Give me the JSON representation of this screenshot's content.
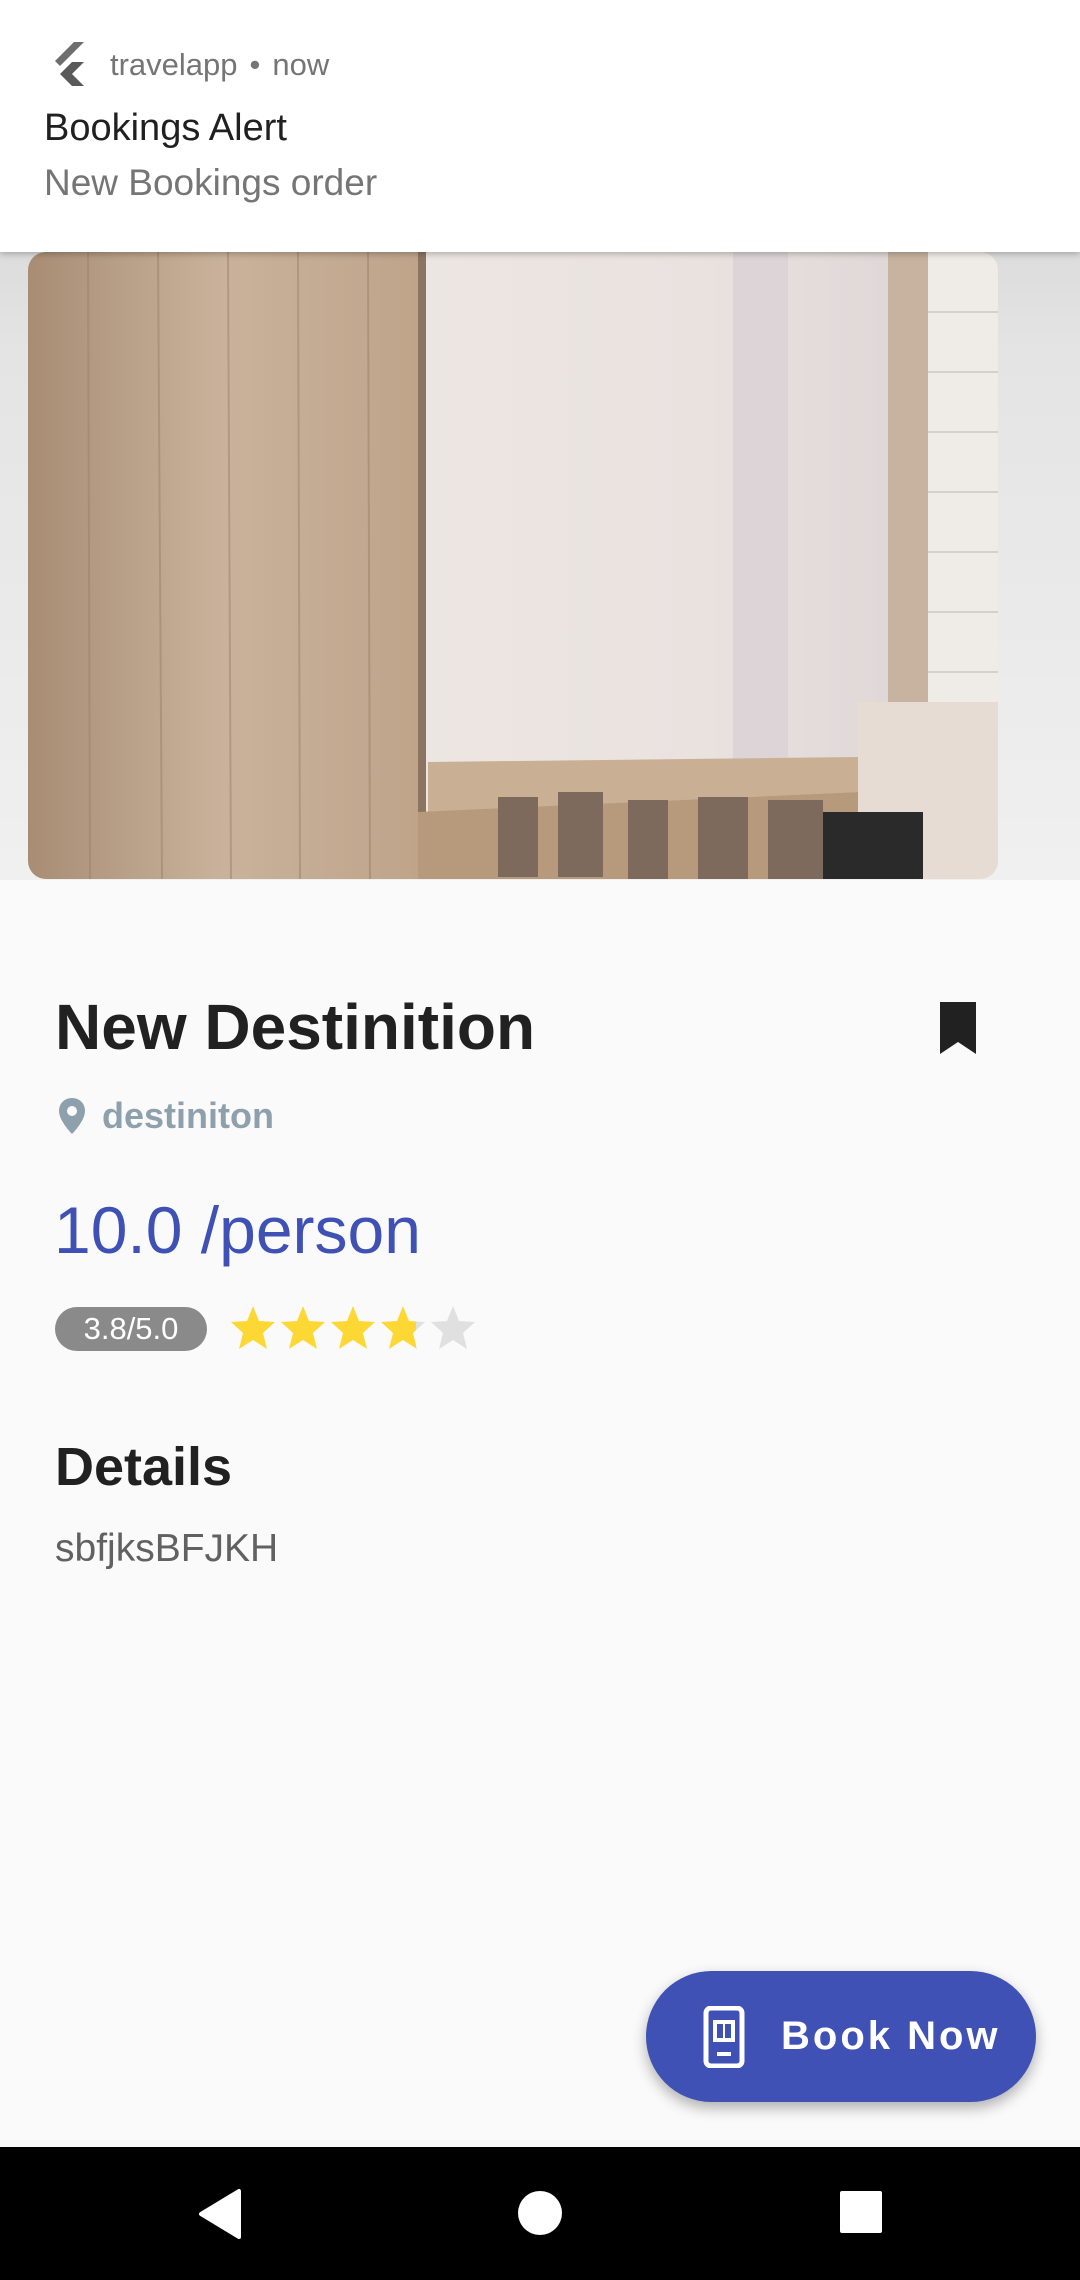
{
  "notification": {
    "app_name": "travelapp",
    "separator": "•",
    "time": "now",
    "title": "Bookings Alert",
    "body": "New Bookings order"
  },
  "destination": {
    "title": "New Destinition",
    "location": "destiniton",
    "price": "10.0 /person",
    "rating_text": "3.8/5.0",
    "rating_value": 3.8,
    "rating_max": 5
  },
  "details": {
    "heading": "Details",
    "text": "sbfjksBFJKH"
  },
  "book_button": {
    "label": "Book Now"
  },
  "colors": {
    "accent": "#3f51b5",
    "star": "#fdd835",
    "star_empty": "#e0e0e0",
    "location": "#8fa0ad"
  },
  "icons": {
    "app": "flutter-logo-icon",
    "bookmark": "bookmark-icon",
    "location": "location-pin-icon",
    "book": "smartphone-icon",
    "nav_back": "back-icon",
    "nav_home": "home-icon",
    "nav_recents": "recents-icon"
  }
}
